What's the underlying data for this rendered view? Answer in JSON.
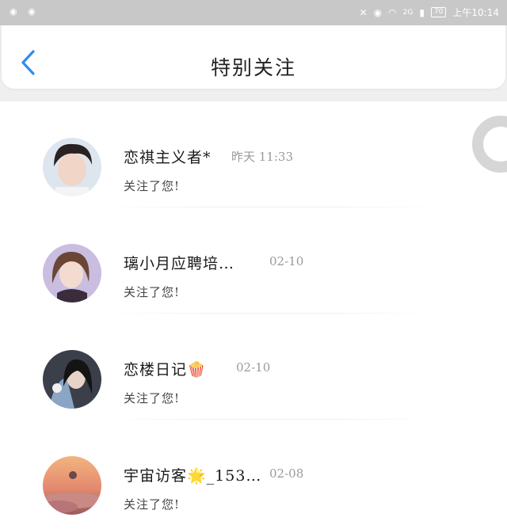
{
  "status_bar": {
    "left_icons": [
      "app-notification-icon",
      "app-notification-icon"
    ],
    "right_icons": [
      "mute-icon",
      "eye-icon",
      "wifi-icon",
      "signal-icon",
      "battery-icon"
    ],
    "network": "2G",
    "battery": "70",
    "time": "上午10:14"
  },
  "header": {
    "back_icon": "back-chevron-icon",
    "title": "特别关注",
    "accent_color": "#2f8cf0"
  },
  "items": [
    {
      "name": "恋祺主义者*",
      "time": "昨天 11:33",
      "message": "关注了您!"
    },
    {
      "name": "璃小月应聘培…",
      "time": "02-10",
      "message": "关注了您!"
    },
    {
      "name": "恋楼日记🍿",
      "time": "02-10",
      "message": "关注了您!"
    },
    {
      "name": "宇宙访客🌟_153…",
      "time": "02-08",
      "message": "关注了您!"
    }
  ]
}
